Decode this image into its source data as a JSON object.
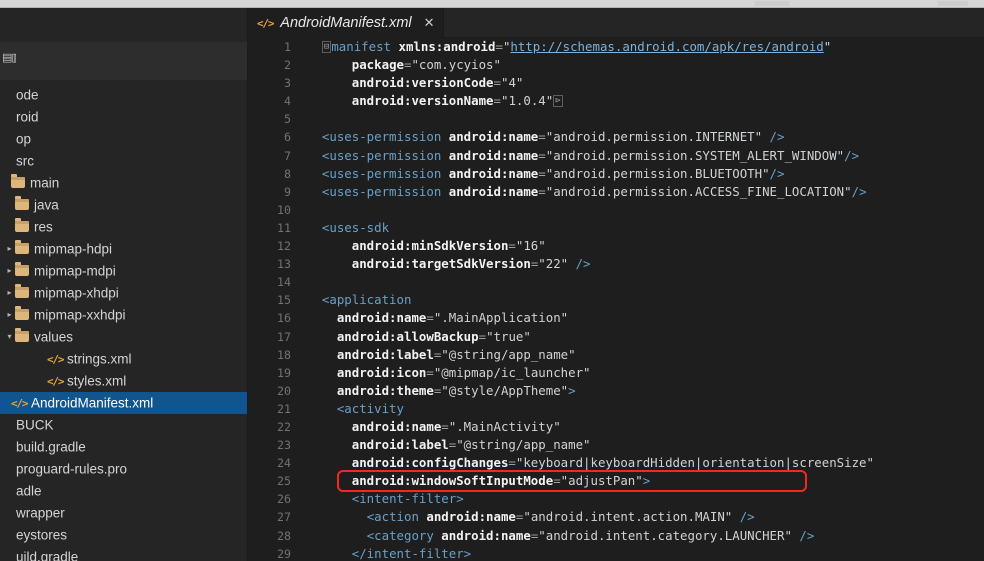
{
  "window": {
    "os_strip_present": true,
    "editor_background": "#1e1e1e",
    "sidebar_background": "#252526",
    "selection_color": "#11558f",
    "annotation_color": "#f02a20"
  },
  "sidebar": {
    "toolbar_icon": "grid-glyph-icon",
    "toolbar_icon_glyph": "▤▥",
    "items": [
      {
        "label": "ode",
        "indent": 0,
        "icon": "none",
        "twisty": "",
        "selected": false
      },
      {
        "label": "roid",
        "indent": 0,
        "icon": "none",
        "twisty": "",
        "selected": false
      },
      {
        "label": "op",
        "indent": 0,
        "icon": "none",
        "twisty": "",
        "selected": false
      },
      {
        "label": "src",
        "indent": 0,
        "icon": "none",
        "twisty": "",
        "selected": false
      },
      {
        "label": "main",
        "indent": 1,
        "icon": "folder",
        "twisty": "",
        "selected": false
      },
      {
        "label": "java",
        "indent": 2,
        "icon": "folder",
        "twisty": "",
        "selected": false
      },
      {
        "label": "res",
        "indent": 2,
        "icon": "folder",
        "twisty": "",
        "selected": false
      },
      {
        "label": "mipmap-hdpi",
        "indent": 2,
        "icon": "folder",
        "twisty": "▸",
        "selected": false
      },
      {
        "label": "mipmap-mdpi",
        "indent": 2,
        "icon": "folder",
        "twisty": "▸",
        "selected": false
      },
      {
        "label": "mipmap-xhdpi",
        "indent": 2,
        "icon": "folder",
        "twisty": "▸",
        "selected": false
      },
      {
        "label": "mipmap-xxhdpi",
        "indent": 2,
        "icon": "folder",
        "twisty": "▸",
        "selected": false
      },
      {
        "label": "values",
        "indent": 2,
        "icon": "folder",
        "twisty": "▾",
        "selected": false
      },
      {
        "label": "strings.xml",
        "indent": 4,
        "icon": "xml",
        "twisty": "",
        "selected": false
      },
      {
        "label": "styles.xml",
        "indent": 4,
        "icon": "xml",
        "twisty": "",
        "selected": false
      },
      {
        "label": "AndroidManifest.xml",
        "indent": 0,
        "icon": "xml",
        "twisty": "",
        "selected": true
      },
      {
        "label": "BUCK",
        "indent": 0,
        "icon": "none",
        "twisty": "",
        "selected": false
      },
      {
        "label": "build.gradle",
        "indent": 0,
        "icon": "none",
        "twisty": "",
        "selected": false
      },
      {
        "label": "proguard-rules.pro",
        "indent": 0,
        "icon": "none",
        "twisty": "",
        "selected": false
      },
      {
        "label": "adle",
        "indent": 0,
        "icon": "none",
        "twisty": "",
        "selected": false
      },
      {
        "label": "wrapper",
        "indent": 0,
        "icon": "none",
        "twisty": "",
        "selected": false
      },
      {
        "label": "eystores",
        "indent": 0,
        "icon": "none",
        "twisty": "",
        "selected": false
      },
      {
        "label": "uild.gradle",
        "indent": 0,
        "icon": "none",
        "twisty": "",
        "selected": false
      }
    ]
  },
  "tabs": [
    {
      "icon": "xml-file-icon",
      "icon_glyph": "</>",
      "title": "AndroidManifest.xml",
      "close_glyph": "✕",
      "active": true
    }
  ],
  "editor": {
    "language": "xml",
    "first_visible_line": 1,
    "last_visible_line": 29,
    "annotation": {
      "type": "red-rectangle",
      "target_line": 25,
      "target_text": "android:windowSoftInputMode=\"adjustPan\">"
    },
    "lines": [
      {
        "n": 1,
        "tokens": [
          {
            "t": "plain",
            "v": "  "
          },
          {
            "t": "fold",
            "v": "⊟"
          },
          {
            "t": "tag",
            "v": "manifest"
          },
          {
            "t": "plain",
            "v": " "
          },
          {
            "t": "attr",
            "v": "xmlns:android"
          },
          {
            "t": "eq",
            "v": "="
          },
          {
            "t": "str",
            "v": "\""
          },
          {
            "t": "link",
            "v": "http://schemas.android.com/apk/res/android"
          },
          {
            "t": "str",
            "v": "\""
          }
        ]
      },
      {
        "n": 2,
        "tokens": [
          {
            "t": "plain",
            "v": "      "
          },
          {
            "t": "attr",
            "v": "package"
          },
          {
            "t": "eq",
            "v": "="
          },
          {
            "t": "str",
            "v": "\"com.ycyios\""
          }
        ]
      },
      {
        "n": 3,
        "tokens": [
          {
            "t": "plain",
            "v": "      "
          },
          {
            "t": "attr",
            "v": "android:versionCode"
          },
          {
            "t": "eq",
            "v": "="
          },
          {
            "t": "str",
            "v": "\"4\""
          }
        ]
      },
      {
        "n": 4,
        "tokens": [
          {
            "t": "plain",
            "v": "      "
          },
          {
            "t": "attr",
            "v": "android:versionName"
          },
          {
            "t": "eq",
            "v": "="
          },
          {
            "t": "str",
            "v": "\"1.0.4\""
          },
          {
            "t": "fold",
            "v": "⊳"
          }
        ]
      },
      {
        "n": 5,
        "tokens": []
      },
      {
        "n": 6,
        "tokens": [
          {
            "t": "plain",
            "v": "  "
          },
          {
            "t": "tag",
            "v": "<uses-permission"
          },
          {
            "t": "plain",
            "v": " "
          },
          {
            "t": "attr",
            "v": "android:name"
          },
          {
            "t": "eq",
            "v": "="
          },
          {
            "t": "str",
            "v": "\"android.permission.INTERNET\""
          },
          {
            "t": "tag",
            "v": " />"
          }
        ]
      },
      {
        "n": 7,
        "tokens": [
          {
            "t": "plain",
            "v": "  "
          },
          {
            "t": "tag",
            "v": "<uses-permission"
          },
          {
            "t": "plain",
            "v": " "
          },
          {
            "t": "attr",
            "v": "android:name"
          },
          {
            "t": "eq",
            "v": "="
          },
          {
            "t": "str",
            "v": "\"android.permission.SYSTEM_ALERT_WINDOW\""
          },
          {
            "t": "tag",
            "v": "/>"
          }
        ]
      },
      {
        "n": 8,
        "tokens": [
          {
            "t": "plain",
            "v": "  "
          },
          {
            "t": "tag",
            "v": "<uses-permission"
          },
          {
            "t": "plain",
            "v": " "
          },
          {
            "t": "attr",
            "v": "android:name"
          },
          {
            "t": "eq",
            "v": "="
          },
          {
            "t": "str",
            "v": "\"android.permission.BLUETOOTH\""
          },
          {
            "t": "tag",
            "v": "/>"
          }
        ]
      },
      {
        "n": 9,
        "tokens": [
          {
            "t": "plain",
            "v": "  "
          },
          {
            "t": "tag",
            "v": "<uses-permission"
          },
          {
            "t": "plain",
            "v": " "
          },
          {
            "t": "attr",
            "v": "android:name"
          },
          {
            "t": "eq",
            "v": "="
          },
          {
            "t": "str",
            "v": "\"android.permission.ACCESS_FINE_LOCATION\""
          },
          {
            "t": "tag",
            "v": "/>"
          }
        ]
      },
      {
        "n": 10,
        "tokens": []
      },
      {
        "n": 11,
        "tokens": [
          {
            "t": "plain",
            "v": "  "
          },
          {
            "t": "tag",
            "v": "<uses-sdk"
          }
        ]
      },
      {
        "n": 12,
        "tokens": [
          {
            "t": "plain",
            "v": "      "
          },
          {
            "t": "attr",
            "v": "android:minSdkVersion"
          },
          {
            "t": "eq",
            "v": "="
          },
          {
            "t": "str",
            "v": "\"16\""
          }
        ]
      },
      {
        "n": 13,
        "tokens": [
          {
            "t": "plain",
            "v": "      "
          },
          {
            "t": "attr",
            "v": "android:targetSdkVersion"
          },
          {
            "t": "eq",
            "v": "="
          },
          {
            "t": "str",
            "v": "\"22\""
          },
          {
            "t": "tag",
            "v": " />"
          }
        ]
      },
      {
        "n": 14,
        "tokens": []
      },
      {
        "n": 15,
        "tokens": [
          {
            "t": "plain",
            "v": "  "
          },
          {
            "t": "tag",
            "v": "<application"
          }
        ]
      },
      {
        "n": 16,
        "tokens": [
          {
            "t": "plain",
            "v": "    "
          },
          {
            "t": "attr",
            "v": "android:name"
          },
          {
            "t": "eq",
            "v": "="
          },
          {
            "t": "str",
            "v": "\".MainApplication\""
          }
        ]
      },
      {
        "n": 17,
        "tokens": [
          {
            "t": "plain",
            "v": "    "
          },
          {
            "t": "attr",
            "v": "android:allowBackup"
          },
          {
            "t": "eq",
            "v": "="
          },
          {
            "t": "str",
            "v": "\"true\""
          }
        ]
      },
      {
        "n": 18,
        "tokens": [
          {
            "t": "plain",
            "v": "    "
          },
          {
            "t": "attr",
            "v": "android:label"
          },
          {
            "t": "eq",
            "v": "="
          },
          {
            "t": "str",
            "v": "\"@string/app_name\""
          }
        ]
      },
      {
        "n": 19,
        "tokens": [
          {
            "t": "plain",
            "v": "    "
          },
          {
            "t": "attr",
            "v": "android:icon"
          },
          {
            "t": "eq",
            "v": "="
          },
          {
            "t": "str",
            "v": "\"@mipmap/ic_launcher\""
          }
        ]
      },
      {
        "n": 20,
        "tokens": [
          {
            "t": "plain",
            "v": "    "
          },
          {
            "t": "attr",
            "v": "android:theme"
          },
          {
            "t": "eq",
            "v": "="
          },
          {
            "t": "str",
            "v": "\"@style/AppTheme\""
          },
          {
            "t": "tag",
            "v": ">"
          }
        ]
      },
      {
        "n": 21,
        "tokens": [
          {
            "t": "plain",
            "v": "    "
          },
          {
            "t": "tag",
            "v": "<activity"
          }
        ]
      },
      {
        "n": 22,
        "tokens": [
          {
            "t": "plain",
            "v": "      "
          },
          {
            "t": "attr",
            "v": "android:name"
          },
          {
            "t": "eq",
            "v": "="
          },
          {
            "t": "str",
            "v": "\".MainActivity\""
          }
        ]
      },
      {
        "n": 23,
        "tokens": [
          {
            "t": "plain",
            "v": "      "
          },
          {
            "t": "attr",
            "v": "android:label"
          },
          {
            "t": "eq",
            "v": "="
          },
          {
            "t": "str",
            "v": "\"@string/app_name\""
          }
        ]
      },
      {
        "n": 24,
        "tokens": [
          {
            "t": "plain",
            "v": "      "
          },
          {
            "t": "attr",
            "v": "android:configChanges"
          },
          {
            "t": "eq",
            "v": "="
          },
          {
            "t": "str",
            "v": "\"keyboard|keyboardHidden|orientation|screenSize\""
          }
        ]
      },
      {
        "n": 25,
        "tokens": [
          {
            "t": "plain",
            "v": "      "
          },
          {
            "t": "attr",
            "v": "android:windowSoftInputMode"
          },
          {
            "t": "eq",
            "v": "="
          },
          {
            "t": "str",
            "v": "\"adjustPan\""
          },
          {
            "t": "tag",
            "v": ">"
          }
        ]
      },
      {
        "n": 26,
        "tokens": [
          {
            "t": "plain",
            "v": "      "
          },
          {
            "t": "tag",
            "v": "<intent-filter>"
          }
        ]
      },
      {
        "n": 27,
        "tokens": [
          {
            "t": "plain",
            "v": "        "
          },
          {
            "t": "tag",
            "v": "<action"
          },
          {
            "t": "plain",
            "v": " "
          },
          {
            "t": "attr",
            "v": "android:name"
          },
          {
            "t": "eq",
            "v": "="
          },
          {
            "t": "str",
            "v": "\"android.intent.action.MAIN\""
          },
          {
            "t": "tag",
            "v": " />"
          }
        ]
      },
      {
        "n": 28,
        "tokens": [
          {
            "t": "plain",
            "v": "        "
          },
          {
            "t": "tag",
            "v": "<category"
          },
          {
            "t": "plain",
            "v": " "
          },
          {
            "t": "attr",
            "v": "android:name"
          },
          {
            "t": "eq",
            "v": "="
          },
          {
            "t": "str",
            "v": "\"android.intent.category.LAUNCHER\""
          },
          {
            "t": "tag",
            "v": " />"
          }
        ]
      },
      {
        "n": 29,
        "tokens": [
          {
            "t": "plain",
            "v": "      "
          },
          {
            "t": "tag",
            "v": "</intent-filter>"
          }
        ]
      }
    ]
  }
}
